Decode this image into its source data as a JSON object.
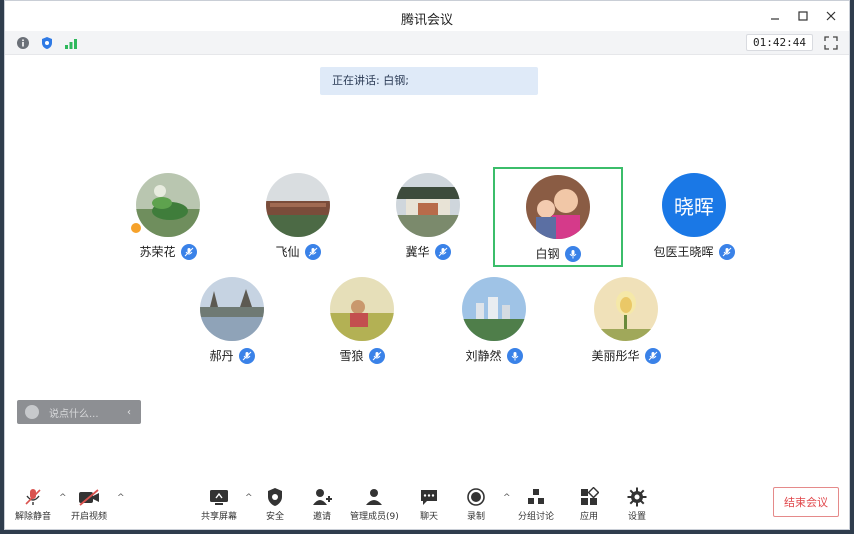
{
  "window": {
    "title": "腾讯会议"
  },
  "infobar": {
    "timer": "01:42:44"
  },
  "speaking": {
    "text": "正在讲话: 白钢;"
  },
  "participants": [
    {
      "name": "苏荣花",
      "avatar": "photo-plant",
      "host": true
    },
    {
      "name": "飞仙",
      "avatar": "photo-street"
    },
    {
      "name": "冀华",
      "avatar": "photo-building"
    },
    {
      "name": "白钢",
      "avatar": "photo-people",
      "active": true,
      "speaking": true
    },
    {
      "name": "包医王晓晖",
      "avatar_text": "晓晖"
    },
    {
      "name": "郝丹",
      "avatar": "photo-lake"
    },
    {
      "name": "雪狼",
      "avatar": "photo-field"
    },
    {
      "name": "刘静然",
      "avatar": "photo-city",
      "speaking": true
    },
    {
      "name": "美丽彤华",
      "avatar": "photo-flower"
    }
  ],
  "chat": {
    "placeholder": "说点什么..."
  },
  "toolbar": {
    "mute": "解除静音",
    "video": "开启视频",
    "share": "共享屏幕",
    "security": "安全",
    "invite": "邀请",
    "manage": "管理成员(9)",
    "chat": "聊天",
    "record": "录制",
    "breakout": "分组讨论",
    "apps": "应用",
    "settings": "设置",
    "end": "结束会议"
  },
  "colors": {
    "accent": "#3a82e8",
    "active_border": "#3bbd6a",
    "end": "#e0464a"
  }
}
